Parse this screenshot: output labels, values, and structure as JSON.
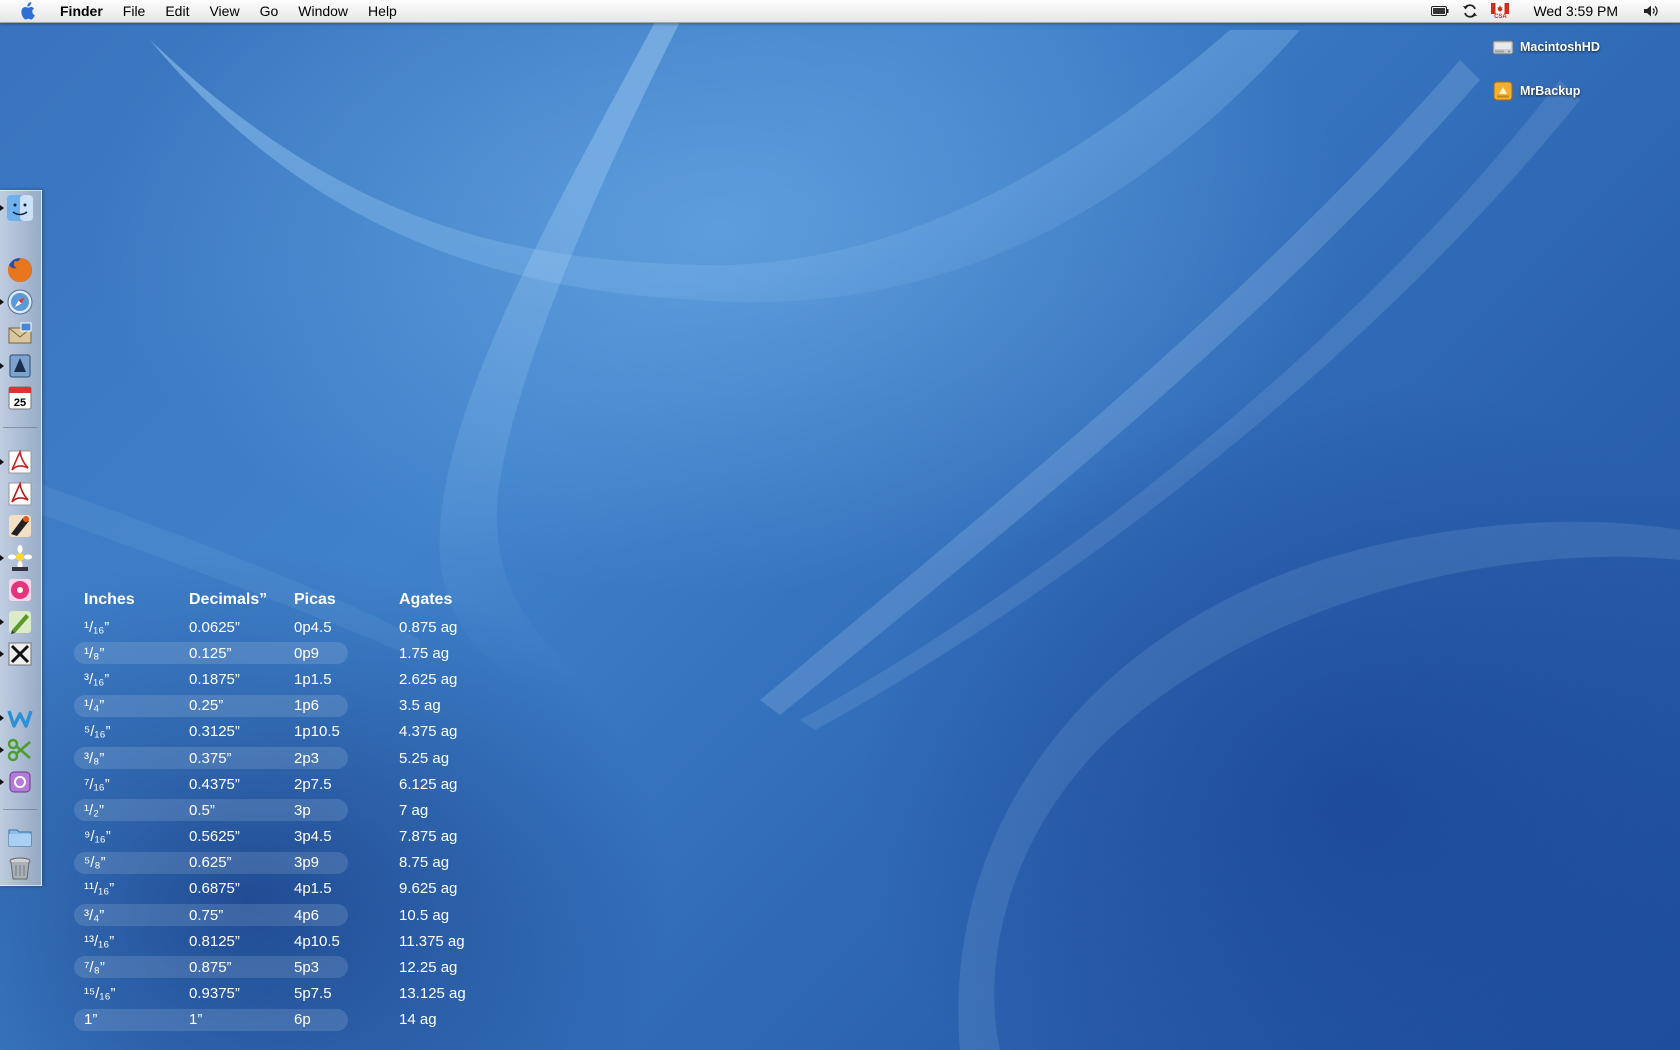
{
  "menubar": {
    "app_name": "Finder",
    "items": [
      "File",
      "Edit",
      "View",
      "Go",
      "Window",
      "Help"
    ],
    "clock": "Wed 3:59 PM",
    "flag_label": "CSA"
  },
  "desktop_icons": [
    {
      "label": "MacintoshHD"
    },
    {
      "label": "MrBackup"
    }
  ],
  "calendar_date": "25",
  "conversion_table": {
    "headers": [
      "Inches",
      "Decimals”",
      "Picas",
      "Agates"
    ],
    "rows": [
      {
        "inches": "¹/₁₆”",
        "decimal": "0.0625”",
        "picas": "0p4.5",
        "agates": "0.875 ag"
      },
      {
        "inches": "¹/₈”",
        "decimal": "0.125”",
        "picas": "0p9",
        "agates": "1.75 ag"
      },
      {
        "inches": "³/₁₆”",
        "decimal": "0.1875”",
        "picas": "1p1.5",
        "agates": "2.625 ag"
      },
      {
        "inches": "¹/₄”",
        "decimal": "0.25”",
        "picas": "1p6",
        "agates": "3.5 ag"
      },
      {
        "inches": "⁵/₁₆”",
        "decimal": "0.3125”",
        "picas": "1p10.5",
        "agates": "4.375 ag"
      },
      {
        "inches": "³/₈”",
        "decimal": "0.375”",
        "picas": "2p3",
        "agates": "5.25 ag"
      },
      {
        "inches": "⁷/₁₆”",
        "decimal": "0.4375”",
        "picas": "2p7.5",
        "agates": "6.125 ag"
      },
      {
        "inches": "¹/₂”",
        "decimal": "0.5”",
        "picas": "3p",
        "agates": "7 ag"
      },
      {
        "inches": "⁹/₁₆”",
        "decimal": "0.5625”",
        "picas": "3p4.5",
        "agates": "7.875 ag"
      },
      {
        "inches": "⁵/₈”",
        "decimal": "0.625”",
        "picas": "3p9",
        "agates": "8.75 ag"
      },
      {
        "inches": "¹¹/₁₆”",
        "decimal": "0.6875”",
        "picas": "4p1.5",
        "agates": "9.625 ag"
      },
      {
        "inches": "³/₄”",
        "decimal": "0.75”",
        "picas": "4p6",
        "agates": "10.5 ag"
      },
      {
        "inches": "¹³/₁₆”",
        "decimal": "0.8125”",
        "picas": "4p10.5",
        "agates": "11.375 ag"
      },
      {
        "inches": "⁷/₈”",
        "decimal": "0.875”",
        "picas": "5p3",
        "agates": "12.25 ag"
      },
      {
        "inches": "¹⁵/₁₆”",
        "decimal": "0.9375”",
        "picas": "5p7.5",
        "agates": "13.125 ag"
      },
      {
        "inches": "1”",
        "decimal": "1”",
        "picas": "6p",
        "agates": "14 ag"
      }
    ]
  }
}
